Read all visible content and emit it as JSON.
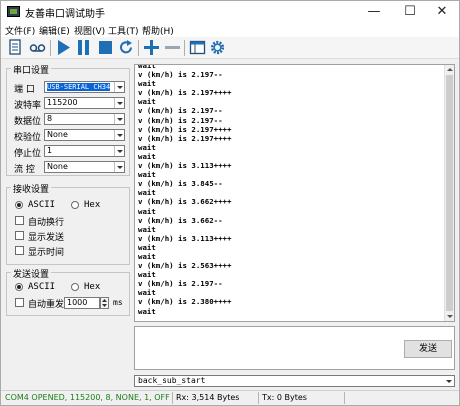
{
  "window": {
    "title": "友善串口调试助手",
    "controls": {
      "minimize": "—",
      "maximize": "☐",
      "close": "✕"
    }
  },
  "menu": [
    "文件(F)",
    "编辑(E)",
    "视图(V)",
    "工具(T)",
    "帮助(H)"
  ],
  "toolbar": {
    "icons": [
      "new-document-icon",
      "record-icon",
      "play-icon",
      "pause-icon",
      "stop-icon",
      "refresh-icon",
      "add-icon",
      "remove-icon",
      "window-icon",
      "gear-icon"
    ],
    "colors": {
      "blue": "#1f6fb5",
      "dark": "#1f4e79"
    }
  },
  "serial_settings": {
    "title": "串口设置",
    "port_label": "端  口",
    "port_value": "USB-SERIAL CH34",
    "baud_label": "波特率",
    "baud_value": "115200",
    "databits_label": "数据位",
    "databits_value": "8",
    "parity_label": "校验位",
    "parity_value": "None",
    "stopbits_label": "停止位",
    "stopbits_value": "1",
    "flow_label": "流  控",
    "flow_value": "None"
  },
  "receive_settings": {
    "title": "接收设置",
    "ascii": "ASCII",
    "hex": "Hex",
    "auto_wrap": "自动换行",
    "show_send": "显示发送",
    "show_time": "显示时间"
  },
  "send_settings": {
    "title": "发送设置",
    "ascii": "ASCII",
    "hex": "Hex",
    "auto_resend": "自动重发",
    "interval": "1000",
    "unit": "ms"
  },
  "receive_text": [
    "wait",
    "v (km/h) is 2.197--",
    "wait",
    "v (km/h) is 2.197++++",
    "wait",
    "v (km/h) is 2.197--",
    "v (km/h) is 2.197--",
    "v (km/h) is 2.197++++",
    "v (km/h) is 2.197++++",
    "wait",
    "wait",
    "v (km/h) is 3.113++++",
    "wait",
    "v (km/h) is 3.845--",
    "wait",
    "v (km/h) is 3.662++++",
    "wait",
    "v (km/h) is 3.662--",
    "wait",
    "v (km/h) is 3.113++++",
    "wait",
    "wait",
    "v (km/h) is 2.563++++",
    "wait",
    "v (km/h) is 2.197--",
    "wait",
    "v (km/h) is 2.380++++",
    "wait"
  ],
  "send_button": "发送",
  "command_value": "back_sub_start",
  "status": {
    "port": "COM4 OPENED, 115200, 8, NONE, 1, OFF",
    "rx": "Rx: 3,514 Bytes",
    "tx": "Tx: 0 Bytes",
    "port_color": "#1a7f1a"
  }
}
